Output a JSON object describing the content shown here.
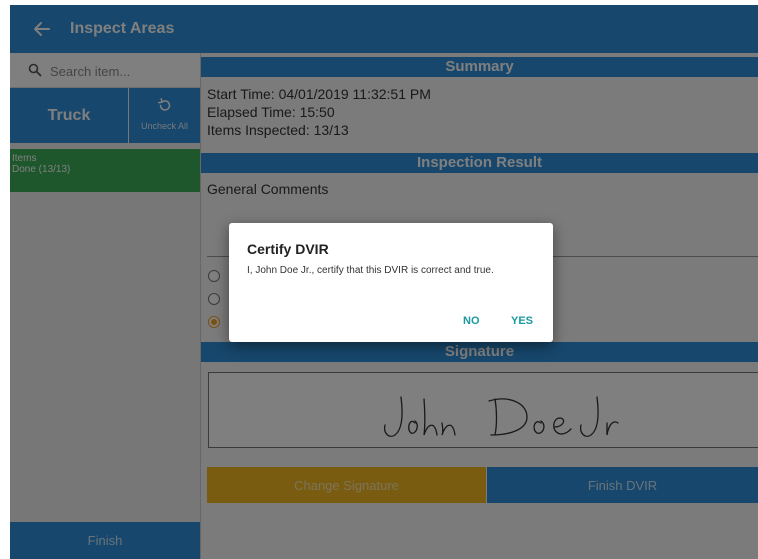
{
  "app_bar": {
    "title": "Inspect Areas",
    "back_icon": "arrow-left-icon"
  },
  "sidebar": {
    "search": {
      "placeholder": "Search item...",
      "value": "",
      "icon": "search-icon"
    },
    "tab": {
      "label": "Truck"
    },
    "uncheck_all": {
      "label": "Uncheck All",
      "icon": "undo-icon"
    },
    "items": [
      {
        "title": "Items",
        "status": "Done (13/13)"
      }
    ],
    "finish_label": "Finish"
  },
  "summary": {
    "header": "Summary",
    "start_time": "Start Time: 04/01/2019 11:32:51 PM",
    "elapsed_time": "Elapsed Time: 15:50",
    "items_inspected": "Items Inspected: 13/13"
  },
  "inspection_result": {
    "header": "Inspection Result",
    "general_comments_label": "General Comments",
    "radio_options": [
      {
        "selected": false
      },
      {
        "selected": false
      },
      {
        "selected": true
      }
    ]
  },
  "signature": {
    "header": "Signature",
    "signer": "John Doe Jr"
  },
  "buttons": {
    "change_signature": "Change Signature",
    "finish_dvir": "Finish DVIR"
  },
  "dialog": {
    "title": "Certify DVIR",
    "message": "I, John Doe Jr., certify that this DVIR is correct and true.",
    "no_label": "NO",
    "yes_label": "YES",
    "accent_color": "#1a9aa0"
  },
  "colors": {
    "primary": "#2e8fd8",
    "success": "#3cae58",
    "warning": "#f4b821",
    "radio_selected": "#f3a324"
  }
}
